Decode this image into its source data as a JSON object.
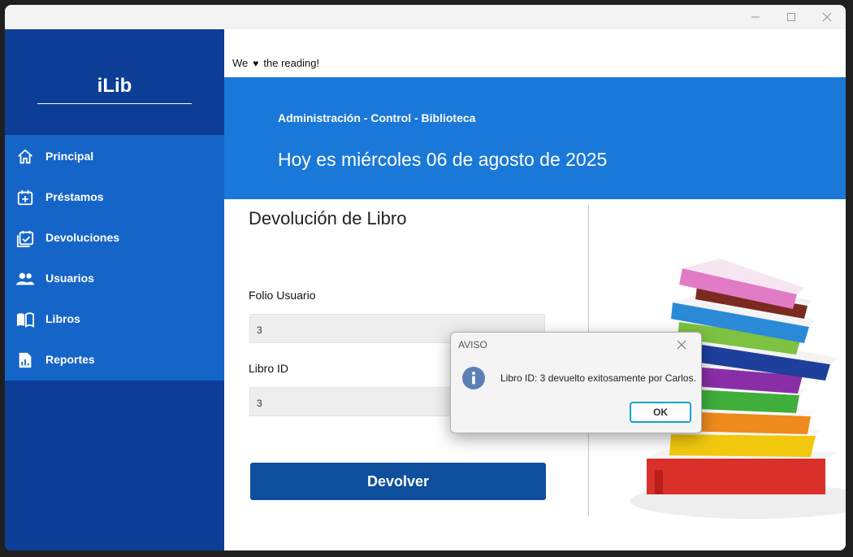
{
  "app": {
    "logo": "iLib",
    "tagline_pre": "We",
    "tagline_post": "the reading!"
  },
  "sidebar": {
    "items": [
      {
        "label": "Principal",
        "icon": "home-icon"
      },
      {
        "label": "Préstamos",
        "icon": "calendar-plus-icon"
      },
      {
        "label": "Devoluciones",
        "icon": "calendar-check-icon"
      },
      {
        "label": "Usuarios",
        "icon": "users-icon"
      },
      {
        "label": "Libros",
        "icon": "book-open-icon"
      },
      {
        "label": "Reportes",
        "icon": "report-icon"
      }
    ]
  },
  "banner": {
    "subtitle": "Administración - Control - Biblioteca",
    "date": "Hoy es miércoles 06 de agosto de 2025"
  },
  "form": {
    "title": "Devolución de Libro",
    "folio_label": "Folio Usuario",
    "folio_value": "3",
    "libro_label": "Libro ID",
    "libro_value": "3",
    "submit_label": "Devolver"
  },
  "dialog": {
    "title": "AVISO",
    "message": "Libro ID: 3 devuelto exitosamente por Carlos.",
    "ok_label": "OK"
  },
  "colors": {
    "sidebar_dark": "#0c3e96",
    "sidebar_nav": "#1565c9",
    "banner": "#1a78d8",
    "button": "#0e4f9e",
    "focus_ring": "#13a4c4"
  }
}
